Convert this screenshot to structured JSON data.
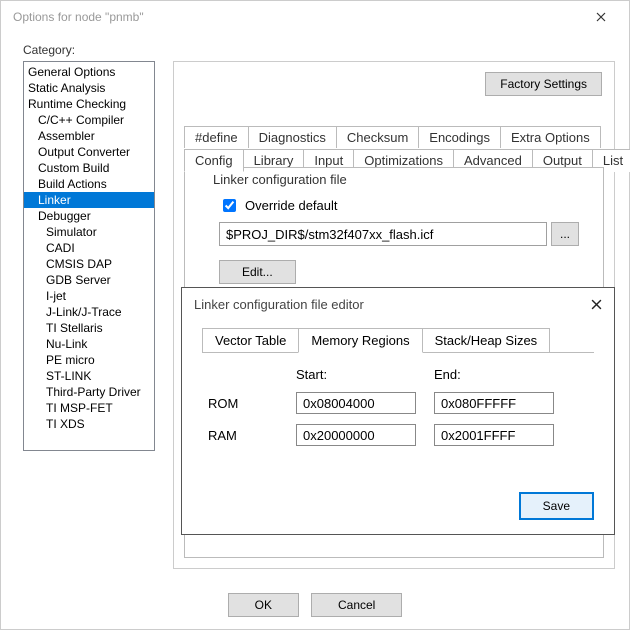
{
  "window": {
    "title": "Options for node \"pnmb\""
  },
  "categoryLabel": "Category:",
  "tree": [
    {
      "label": "General Options",
      "indent": 0
    },
    {
      "label": "Static Analysis",
      "indent": 0
    },
    {
      "label": "Runtime Checking",
      "indent": 0
    },
    {
      "label": "C/C++ Compiler",
      "indent": 1
    },
    {
      "label": "Assembler",
      "indent": 1
    },
    {
      "label": "Output Converter",
      "indent": 1
    },
    {
      "label": "Custom Build",
      "indent": 1
    },
    {
      "label": "Build Actions",
      "indent": 1
    },
    {
      "label": "Linker",
      "indent": 1,
      "sel": true
    },
    {
      "label": "Debugger",
      "indent": 1
    },
    {
      "label": "Simulator",
      "indent": 2
    },
    {
      "label": "CADI",
      "indent": 2
    },
    {
      "label": "CMSIS DAP",
      "indent": 2
    },
    {
      "label": "GDB Server",
      "indent": 2
    },
    {
      "label": "I-jet",
      "indent": 2
    },
    {
      "label": "J-Link/J-Trace",
      "indent": 2
    },
    {
      "label": "TI Stellaris",
      "indent": 2
    },
    {
      "label": "Nu-Link",
      "indent": 2
    },
    {
      "label": "PE micro",
      "indent": 2
    },
    {
      "label": "ST-LINK",
      "indent": 2
    },
    {
      "label": "Third-Party Driver",
      "indent": 2
    },
    {
      "label": "TI MSP-FET",
      "indent": 2
    },
    {
      "label": "TI XDS",
      "indent": 2
    }
  ],
  "factoryButton": "Factory Settings",
  "tabsRow1": [
    "#define",
    "Diagnostics",
    "Checksum",
    "Encodings",
    "Extra Options"
  ],
  "tabsRow2": [
    "Config",
    "Library",
    "Input",
    "Optimizations",
    "Advanced",
    "Output",
    "List"
  ],
  "activeTab": "Config",
  "configGroup": {
    "title": "Linker configuration file",
    "overrideLabel": "Override default",
    "overrideChecked": true,
    "path": "$PROJ_DIR$/stm32f407xx_flash.icf",
    "browse": "...",
    "editBtn": "Edit..."
  },
  "editor": {
    "title": "Linker configuration file editor",
    "tabs": [
      "Vector Table",
      "Memory Regions",
      "Stack/Heap Sizes"
    ],
    "activeTab": "Memory Regions",
    "cols": {
      "start": "Start:",
      "end": "End:"
    },
    "rows": [
      {
        "name": "ROM",
        "start": "0x08004000",
        "end": "0x080FFFFF"
      },
      {
        "name": "RAM",
        "start": "0x20000000",
        "end": "0x2001FFFF"
      }
    ],
    "save": "Save"
  },
  "footer": {
    "ok": "OK",
    "cancel": "Cancel"
  }
}
